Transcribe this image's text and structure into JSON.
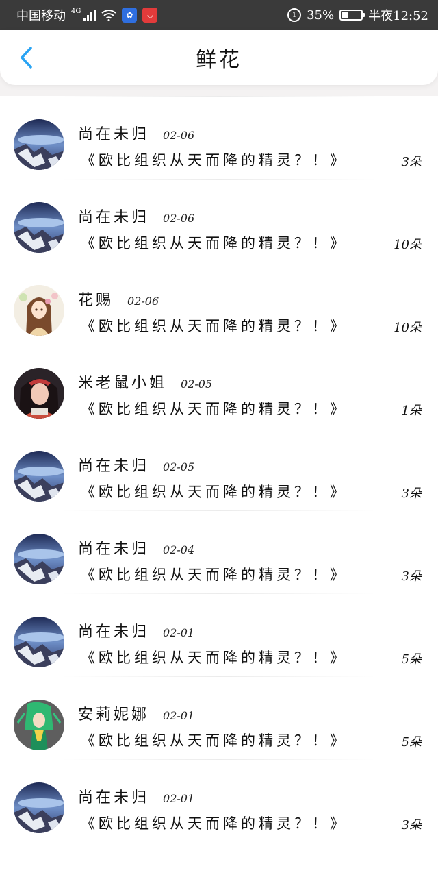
{
  "status_bar": {
    "carrier": "中国移动",
    "network": "4G",
    "battery_percent": "35%",
    "time": "半夜12:52",
    "battery_level": 0.35
  },
  "header": {
    "title": "鲜花",
    "back_icon": "chevron-left-icon"
  },
  "colors": {
    "accent": "#2aa4f4",
    "status_bar_bg": "#3a3a3a"
  },
  "items": [
    {
      "name": "尚在未归",
      "date": "02-06",
      "message": "《欧比组织从天而降的精灵？！》",
      "count": "3朵",
      "avatar": "lake-avatar"
    },
    {
      "name": "尚在未归",
      "date": "02-06",
      "message": "《欧比组织从天而降的精灵？！》",
      "count": "10朵",
      "avatar": "lake-avatar"
    },
    {
      "name": "花赐",
      "date": "02-06",
      "message": "《欧比组织从天而降的精灵？！》",
      "count": "10朵",
      "avatar": "anime-girl-avatar"
    },
    {
      "name": "米老鼠小姐",
      "date": "02-05",
      "message": "《欧比组织从天而降的精灵？！》",
      "count": "1朵",
      "avatar": "portrait-avatar"
    },
    {
      "name": "尚在未归",
      "date": "02-05",
      "message": "《欧比组织从天而降的精灵？！》",
      "count": "3朵",
      "avatar": "lake-avatar"
    },
    {
      "name": "尚在未归",
      "date": "02-04",
      "message": "《欧比组织从天而降的精灵？！》",
      "count": "3朵",
      "avatar": "lake-avatar"
    },
    {
      "name": "尚在未归",
      "date": "02-01",
      "message": "《欧比组织从天而降的精灵？！》",
      "count": "5朵",
      "avatar": "lake-avatar"
    },
    {
      "name": "安莉妮娜",
      "date": "02-01",
      "message": "《欧比组织从天而降的精灵？！》",
      "count": "5朵",
      "avatar": "green-character-avatar"
    },
    {
      "name": "尚在未归",
      "date": "02-01",
      "message": "《欧比组织从天而降的精灵？！》",
      "count": "3朵",
      "avatar": "lake-avatar"
    }
  ]
}
